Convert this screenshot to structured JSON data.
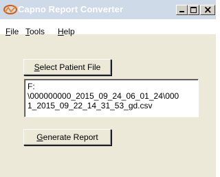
{
  "window": {
    "title": "Capno Report Converter",
    "icon": "app-logo-icon",
    "accent": "#cfdae9"
  },
  "menu": {
    "file": {
      "key": "F",
      "rest": "ile"
    },
    "tools": {
      "key": "T",
      "rest": "ools"
    },
    "help": {
      "key": "H",
      "rest": "elp"
    }
  },
  "buttons": {
    "select": {
      "key": "S",
      "rest": "elect Patient File"
    },
    "generate": {
      "key": "G",
      "rest": "enerate Report"
    }
  },
  "file_path": "F:\n\\000000000_2015_09_24_06_01_24\\000\n1_2015_09_22_14_31_53_gd.csv"
}
